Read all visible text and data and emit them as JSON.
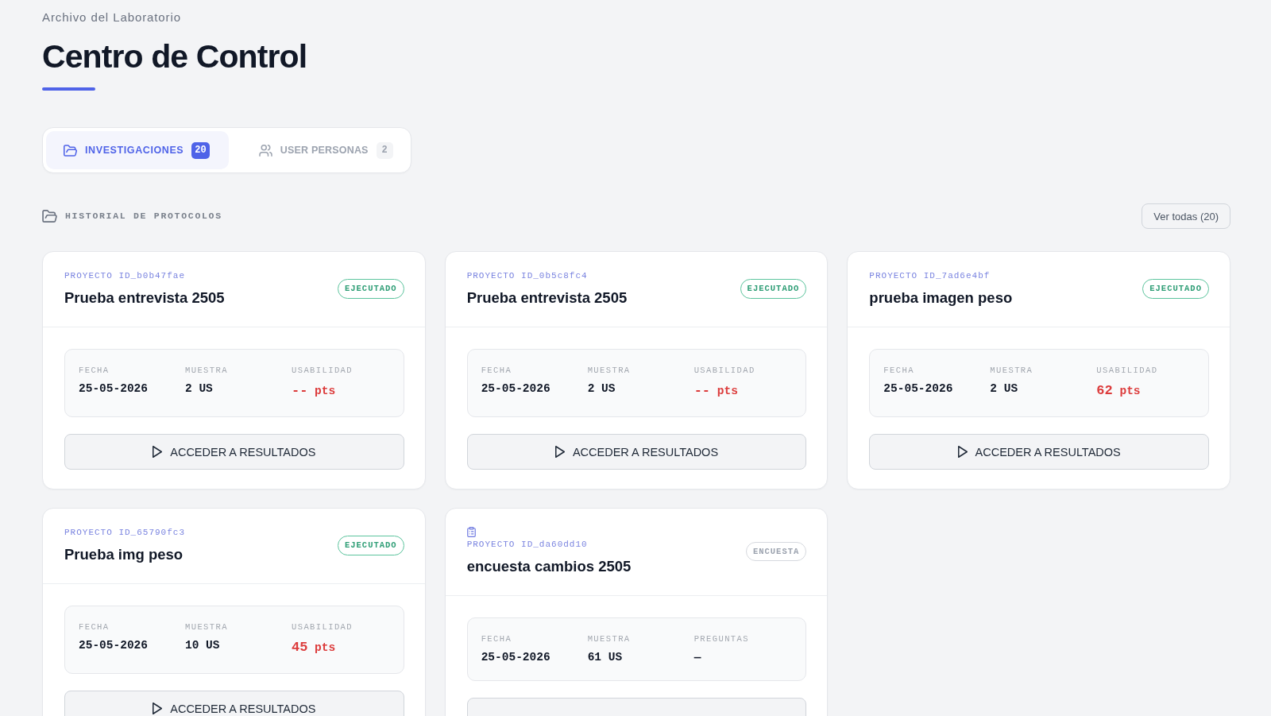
{
  "header": {
    "eyebrow": "Archivo del Laboratorio",
    "title": "Centro de Control"
  },
  "tabs": [
    {
      "kind": "studies",
      "label": "INVESTIGACIONES",
      "count": "20",
      "selected": true
    },
    {
      "kind": "personas",
      "label": "USER PERSONAS",
      "count": "2",
      "selected": false
    }
  ],
  "section": {
    "title": "HISTORIAL DE PROTOCOLOS",
    "view_all": "Ver todas (20)"
  },
  "cards": [
    {
      "kind": "test",
      "project_id": "PROYECTO ID_b0b47fae",
      "title": "Prueba entrevista 2505",
      "status": {
        "kind": "executed",
        "label": "EJECUTADO"
      },
      "metrics": [
        {
          "kind": "text",
          "label": "FECHA",
          "value": "25-05-2026"
        },
        {
          "kind": "text",
          "label": "MUESTRA",
          "value": "2 US"
        },
        {
          "kind": "score",
          "label": "USABILIDAD",
          "value": "--",
          "unit": "pts"
        }
      ],
      "action": {
        "kind": "button",
        "label": "ACCEDER A RESULTADOS"
      }
    },
    {
      "kind": "test",
      "project_id": "PROYECTO ID_0b5c8fc4",
      "title": "Prueba entrevista 2505",
      "status": {
        "kind": "executed",
        "label": "EJECUTADO"
      },
      "metrics": [
        {
          "kind": "text",
          "label": "FECHA",
          "value": "25-05-2026"
        },
        {
          "kind": "text",
          "label": "MUESTRA",
          "value": "2 US"
        },
        {
          "kind": "score",
          "label": "USABILIDAD",
          "value": "--",
          "unit": "pts"
        }
      ],
      "action": {
        "kind": "button",
        "label": "ACCEDER A RESULTADOS"
      }
    },
    {
      "kind": "test",
      "project_id": "PROYECTO ID_7ad6e4bf",
      "title": "prueba imagen peso",
      "status": {
        "kind": "executed",
        "label": "EJECUTADO"
      },
      "metrics": [
        {
          "kind": "text",
          "label": "FECHA",
          "value": "25-05-2026"
        },
        {
          "kind": "text",
          "label": "MUESTRA",
          "value": "2 US"
        },
        {
          "kind": "score",
          "label": "USABILIDAD",
          "value": "62",
          "unit": "pts"
        }
      ],
      "action": {
        "kind": "button",
        "label": "ACCEDER A RESULTADOS"
      }
    },
    {
      "kind": "test",
      "project_id": "PROYECTO ID_65790fc3",
      "title": "Prueba img peso",
      "status": {
        "kind": "executed",
        "label": "EJECUTADO"
      },
      "metrics": [
        {
          "kind": "text",
          "label": "FECHA",
          "value": "25-05-2026"
        },
        {
          "kind": "text",
          "label": "MUESTRA",
          "value": "10 US"
        },
        {
          "kind": "score",
          "label": "USABILIDAD",
          "value": "45",
          "unit": "pts"
        }
      ],
      "action": {
        "kind": "button",
        "label": "ACCEDER A RESULTADOS"
      }
    },
    {
      "kind": "survey",
      "project_id": "PROYECTO ID_da60dd10",
      "title": "encuesta cambios 2505",
      "status": {
        "kind": "survey",
        "label": "ENCUESTA"
      },
      "metrics": [
        {
          "kind": "text",
          "label": "FECHA",
          "value": "25-05-2026"
        },
        {
          "kind": "text",
          "label": "MUESTRA",
          "value": "61 US"
        },
        {
          "kind": "text",
          "label": "PREGUNTAS",
          "value": "—"
        }
      ],
      "action": {
        "kind": "button"
      }
    }
  ]
}
